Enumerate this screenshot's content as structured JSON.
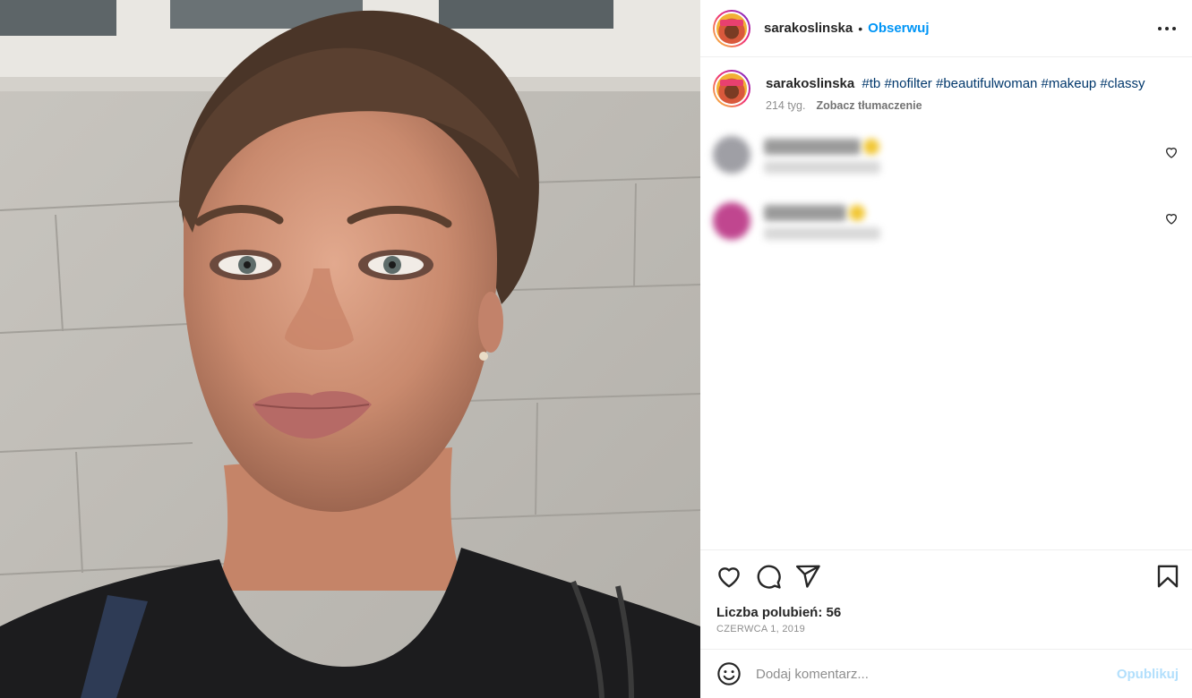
{
  "header": {
    "username": "sarakoslinska",
    "separator": "•",
    "follow_label": "Obserwuj",
    "more_icon": "more-horizontal-icon"
  },
  "caption": {
    "username": "sarakoslinska",
    "hashtags": "#tb #nofilter #beautifulwoman #makeup #classy",
    "age": "214 tyg.",
    "translate_label": "Zobacz tłumaczenie"
  },
  "comments": [
    {
      "blurred": true,
      "like_icon": "heart-outline-icon"
    },
    {
      "blurred": true,
      "like_icon": "heart-outline-icon"
    }
  ],
  "actions": {
    "icons": [
      "heart-outline-icon",
      "comment-icon",
      "share-icon",
      "bookmark-icon"
    ]
  },
  "likes_text": "Liczba polubień: 56",
  "date_text": "CZERWCA 1, 2019",
  "composer": {
    "placeholder": "Dodaj komentarz...",
    "post_label": "Opublikuj",
    "emoji_icon": "emoji-icon"
  },
  "colors": {
    "link_blue": "#0095f6",
    "hashtag_blue": "#00376b",
    "muted_gray": "#8e8e8e",
    "post_disabled": "#b2dffc"
  }
}
